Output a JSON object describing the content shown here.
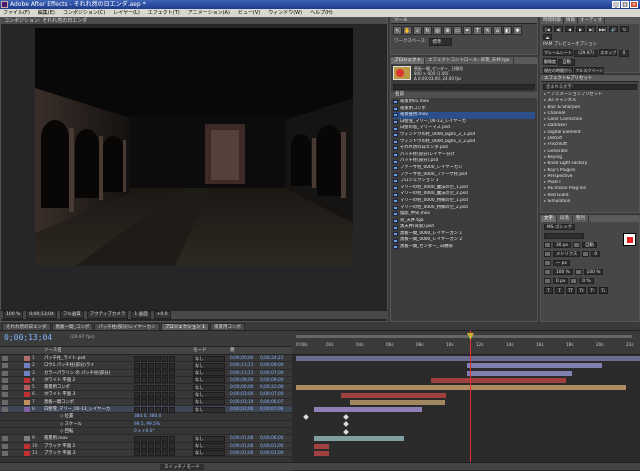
{
  "app": {
    "title": "Adobe After Effects - それれ然の日エンダ.aep *",
    "win": [
      "_",
      "□",
      "×"
    ]
  },
  "menu": [
    "ファイル(F)",
    "編集(E)",
    "コンポジション(C)",
    "レイヤー(L)",
    "エフェクト(T)",
    "アニメーション(A)",
    "ビュー(V)",
    "ウィンドウ(W)",
    "ヘルプ(H)"
  ],
  "comp": {
    "tab": "コンポジション: それれ然の日エンダ",
    "zoom": "100 %",
    "timecode": "0;00;13;04",
    "res": "フル画質",
    "camera": "アクティブカメラ",
    "view": "1 画面",
    "offset": "+0.0"
  },
  "tools": {
    "title": "ツール",
    "workspace_label": "ワークスペース:",
    "workspace_value": "標準"
  },
  "project": {
    "tabs": [
      "プロジェクト",
      "エフェクトコントロール: 背景_天井.tga"
    ],
    "thumb_name": "黒板一間_ゼンダー_ 日勝形",
    "thumb_info": "800 × 600 (1.00)",
    "thumb_dur": "Δ 0;00;03;00, 24.00 fps",
    "column": "名前",
    "items": [
      "夜景用01.mov",
      "夜景用コンポ",
      "夜景昼用.mov",
      "白壁雪_マリー_00-13_レイヤーカ",
      "白壁の窓_マリーマス.psd",
      "ウィンドウの柱_0000_bg01_2_1.psd",
      "ウィンドウの柱_0000_bg01_2_2.psd",
      "それれ然の日エンダ.psd",
      "パッチ柱(部分)レイヤー分け",
      "パッチ柱(部分).psd",
      "ファーサ柱_0000_レイヤーカン",
      "ファーサ柱_0000_ファーサ柱.psd",
      "プロジェクション 1",
      "マリーの柱_0000_魔法の空_1.psd",
      "マリーの柱_0000_魔法の空_2.psd",
      "マリーの柱_0000_特殊の空_1.psd",
      "マリーの柱_0000_特殊の空_2.psd",
      "陰影_中央.mov",
      "背_天井.tga",
      "黒天井(背景).psd",
      "黒板一間_0000_レイヤーカン 1",
      "黒板一間_0000_レイヤーカン 2",
      "黒板一間_ゼンダー_ 日勝形"
    ],
    "selected": 2
  },
  "info": {
    "tabs": [
      "時間制御",
      "情報",
      "オーディオ"
    ],
    "controls": [
      "|◀",
      "◀|",
      "◀",
      "▶",
      "▶|",
      "▶▶|",
      "🔊",
      "↻",
      "⏏"
    ],
    "preview_label": "RAM プレビューオプション",
    "frame_rate_label": "フレームレート",
    "frame_rate": "(29.97)",
    "skip_label": "スキップ",
    "skip": "0",
    "res_label": "解像度",
    "res": "自動",
    "from_label": "現在の時間から",
    "full_label": "フルスクリーン"
  },
  "effects": {
    "title": "エフェクト&プリセット",
    "search": "含まれる文字:",
    "items": [
      "* アニメーションプリセット",
      "3D チャンネル",
      "Blur & Sharpen",
      "Channel",
      "Color Correction",
      "DarkSkin",
      "Digital Element",
      "Distort",
      "Frischluft",
      "Generate",
      "Keying",
      "Knoll Light Factory",
      "Koji's Plugins",
      "Perspective",
      "PSOFT",
      "RE:Vision Plug-ins",
      "Red Giant",
      "Simulation"
    ]
  },
  "character": {
    "tabs": [
      "文字",
      "段落",
      "整列"
    ],
    "font": "MS ゴシック",
    "size": "30 px",
    "leading": "自動",
    "tracking": "0",
    "kern": "メトリクス",
    "stroke": "— px",
    "fill_color": "#e02020",
    "scale_v": "100 %",
    "scale_h": "100 %",
    "baseline": "0 px",
    "tsume": "0 %",
    "buttons": [
      "T",
      "T",
      "TT",
      "Tt",
      "T¹",
      "T₁"
    ]
  },
  "timeline": {
    "tabs": [
      "それれ然の日エンダ",
      "黒板一間_コンポ",
      "パッチ柱(部分)レイヤーカン",
      "プロジェクション 1",
      "夜景用コンポ"
    ],
    "active": 3,
    "timecode": "0;00;13;04",
    "fps": "(29.97 fps)",
    "header": "ソース名",
    "mode": "モード",
    "parent": "親",
    "ticks": [
      "0:00s",
      "02s",
      "04s",
      "06s",
      "08s",
      "10s",
      "12s",
      "14s",
      "16s",
      "18s",
      "20s",
      "22s"
    ],
    "layers": [
      {
        "n": "1",
        "name": "パッチ柱_ライト.psd",
        "mode": "なし",
        "in": "0;00;00;00",
        "dur": "0;00;24;22",
        "lbl": "#b07070"
      },
      {
        "n": "2",
        "name": "ロウ1 パッチ柱(部分)ライ",
        "mode": "なし",
        "in": "0;00;11;11",
        "dur": "0;00;09;00",
        "lbl": "#7080c0"
      },
      {
        "n": "3",
        "name": "カラーパラリン の パッチ柱(部分)",
        "mode": "なし",
        "in": "0;00;11;11",
        "dur": "0;00;07;00",
        "lbl": "#7080c0"
      },
      {
        "n": "4",
        "name": "ホワイト 平面 2",
        "mode": "なし",
        "in": "0;00;09;00",
        "dur": "0;00;09;00",
        "lbl": "#c03030"
      },
      {
        "n": "5",
        "name": "夜景用コンポ",
        "mode": "なし",
        "in": "0;00;00;00",
        "dur": "0;00;22;00",
        "lbl": "#b06060"
      },
      {
        "n": "6",
        "name": "ホワイト 平面 3",
        "mode": "なし",
        "in": "0;00;03;00",
        "dur": "0;00;07;00",
        "lbl": "#c03030"
      },
      {
        "n": "7",
        "name": "黒板一間コンポ",
        "mode": "なし",
        "in": "0;00;03;19",
        "dur": "0;00;06;07",
        "lbl": "#c09060"
      },
      {
        "n": "8",
        "name": "白壁雪_マリー_00-13_レイヤーカ",
        "mode": "なし",
        "in": "0;00;01;06",
        "dur": "0;00;07;06",
        "lbl": "#8060a0"
      },
      {
        "n": "",
        "name": "◇ 位置",
        "mode": "",
        "in": "",
        "dur": "",
        "lbl": "",
        "prop": true,
        "val": "384.0, 380.0"
      },
      {
        "n": "",
        "name": "◇ スケール",
        "mode": "",
        "in": "",
        "dur": "",
        "lbl": "",
        "prop": true,
        "val": "99.5, 99.5%"
      },
      {
        "n": "",
        "name": "◇ 回転",
        "mode": "",
        "in": "",
        "dur": "",
        "lbl": "",
        "prop": true,
        "val": "0 x +0.0°"
      },
      {
        "n": "9",
        "name": "夜景用.mov",
        "mode": "なし",
        "in": "0;00;01;06",
        "dur": "0;00;06;00",
        "lbl": "#808080"
      },
      {
        "n": "10",
        "name": "ブラック 平面 2",
        "mode": "なし",
        "in": "0;00;01;06",
        "dur": "0;00;01;00",
        "lbl": "#c03030"
      },
      {
        "n": "11",
        "name": "ブラック 平面 3",
        "mode": "なし",
        "in": "0;00;01;06",
        "dur": "0;00;01;00",
        "lbl": "#c03030"
      }
    ],
    "switch_label": "スイッチ / モード"
  }
}
